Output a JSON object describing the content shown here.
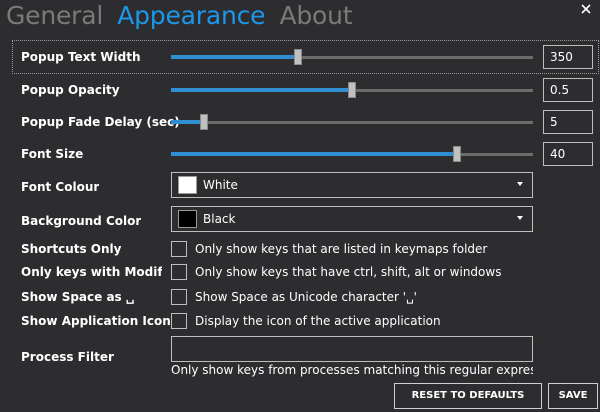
{
  "tabs": [
    {
      "label": "General"
    },
    {
      "label": "Appearance"
    },
    {
      "label": "About"
    }
  ],
  "window": {
    "close_icon": "close-icon"
  },
  "settings": {
    "popup_text_width": {
      "label": "Popup Text Width",
      "value": "350",
      "slider_fraction": 0.35
    },
    "popup_opacity": {
      "label": "Popup Opacity",
      "value": "0.5",
      "slider_fraction": 0.5
    },
    "popup_fade_delay": {
      "label": "Popup Fade Delay (sec)",
      "value": "5",
      "slider_fraction": 0.09
    },
    "font_size": {
      "label": "Font Size",
      "value": "40",
      "slider_fraction": 0.79
    },
    "font_colour": {
      "label": "Font Colour",
      "selected": "White",
      "swatch_color": "#ffffff"
    },
    "background_color": {
      "label": "Background Color",
      "selected": "Black",
      "swatch_color": "#000000"
    },
    "shortcuts_only": {
      "label": "Shortcuts Only",
      "description": "Only show keys that are listed in keymaps folder",
      "checked": false
    },
    "only_keys_with_modifiers": {
      "label": "Only keys with Modifie",
      "description": "Only show keys that have ctrl, shift, alt or windows",
      "checked": false
    },
    "show_space_as": {
      "label": "Show Space as ␣",
      "description": "Show Space as Unicode character '␣'",
      "checked": false
    },
    "show_application_icon": {
      "label": "Show Application Icon",
      "description": "Display the icon of the active application",
      "checked": false
    },
    "process_filter": {
      "label": "Process Filter",
      "value": "",
      "hint": "Only show keys from processes matching this regular expressic"
    }
  },
  "buttons": {
    "reset_label": "RESET TO DEFAULTS",
    "save_label": "SAVE"
  },
  "colors": {
    "accent": "#1c97ea",
    "background": "#2d2d30",
    "slider_fill": "#2f8fd1"
  }
}
